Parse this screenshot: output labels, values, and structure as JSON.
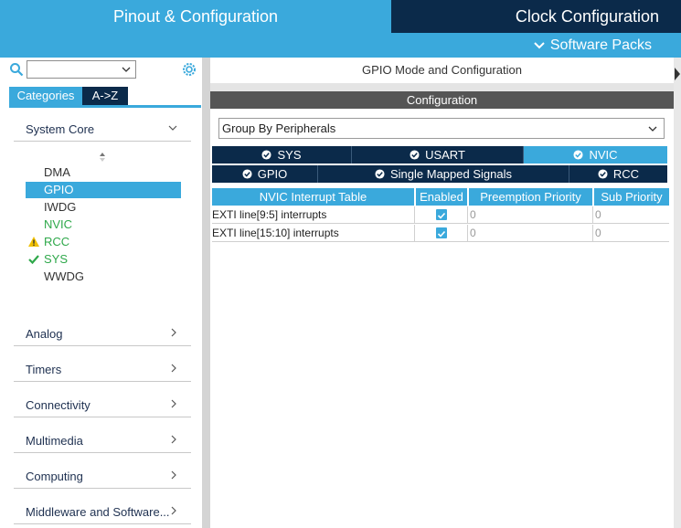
{
  "header": {
    "pinout_title": "Pinout & Configuration",
    "clock_title": "Clock Configuration",
    "software_packs": "Software Packs"
  },
  "sidebar": {
    "search_value": "",
    "tabs": [
      "Categories",
      "A->Z"
    ],
    "section": "System Core",
    "items": [
      {
        "label": "DMA",
        "state": "normal"
      },
      {
        "label": "GPIO",
        "state": "selected"
      },
      {
        "label": "IWDG",
        "state": "normal"
      },
      {
        "label": "NVIC",
        "state": "green"
      },
      {
        "label": "RCC",
        "state": "warning"
      },
      {
        "label": "SYS",
        "state": "ok"
      },
      {
        "label": "WWDG",
        "state": "normal"
      }
    ],
    "categories": [
      "Analog",
      "Timers",
      "Connectivity",
      "Multimedia",
      "Computing",
      "Middleware and Software..."
    ]
  },
  "main": {
    "mode_title": "GPIO Mode and Configuration",
    "config_title": "Configuration",
    "group_by": "Group By Peripherals",
    "tabs_row1": [
      {
        "label": "SYS",
        "active": false
      },
      {
        "label": "USART",
        "active": false
      },
      {
        "label": "NVIC",
        "active": true
      }
    ],
    "tabs_row2": [
      {
        "label": "GPIO",
        "active": false
      },
      {
        "label": "Single Mapped Signals",
        "active": false
      },
      {
        "label": "RCC",
        "active": false
      }
    ],
    "table": {
      "headers": [
        "NVIC Interrupt Table",
        "Enabled",
        "Preemption Priority",
        "Sub Priority"
      ],
      "rows": [
        {
          "name": "EXTI line[9:5] interrupts",
          "enabled": true,
          "preemption": "0",
          "sub": "0"
        },
        {
          "name": "EXTI line[15:10] interrupts",
          "enabled": true,
          "preemption": "0",
          "sub": "0"
        }
      ]
    }
  },
  "colors": {
    "accent": "#3aa9dc",
    "dark": "#0b2a4a",
    "ok_green": "#2ea84a",
    "warning_yellow": "#f0c000"
  }
}
